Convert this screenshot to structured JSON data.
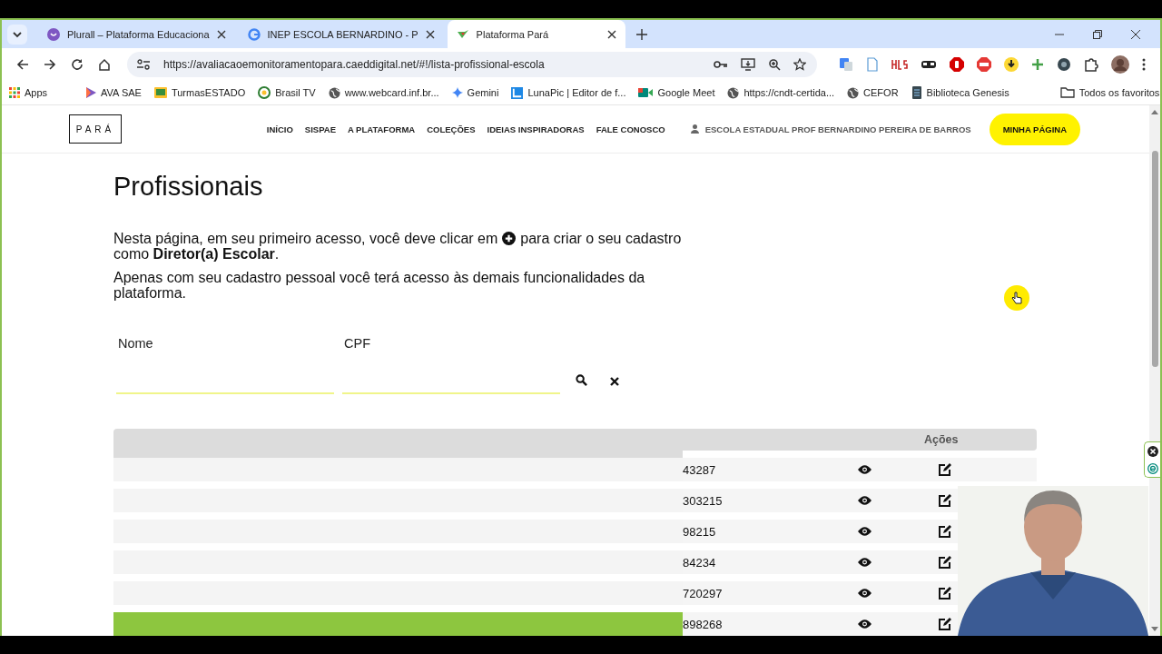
{
  "browser": {
    "tabs": [
      {
        "title": "Plurall – Plataforma Educaciona",
        "selected": false
      },
      {
        "title": "INEP ESCOLA BERNARDINO - P",
        "selected": false
      },
      {
        "title": "Plataforma Pará",
        "selected": true
      }
    ],
    "url": "https://avaliacaoemonitoramentopara.caeddigital.net/#!/lista-profissional-escola",
    "bookmarks": [
      {
        "label": "Apps"
      },
      {
        "label": "AVA SAE"
      },
      {
        "label": "TurmasESTADO"
      },
      {
        "label": "Brasil TV"
      },
      {
        "label": "www.webcard.inf.br..."
      },
      {
        "label": "Gemini"
      },
      {
        "label": "LunaPic | Editor de f..."
      },
      {
        "label": "Google Meet"
      },
      {
        "label": "https://cndt-certida..."
      },
      {
        "label": "CEFOR"
      },
      {
        "label": "Biblioteca Genesis"
      }
    ],
    "all_bookmarks": "Todos os favoritos"
  },
  "site": {
    "logo": "PARÁ",
    "nav": [
      "INÍCIO",
      "SISPAE",
      "A PLATAFORMA",
      "COLEÇÕES",
      "IDEIAS INSPIRADORAS",
      "FALE CONOSCO"
    ],
    "school": "ESCOLA ESTADUAL PROF BERNARDINO PEREIRA DE BARROS",
    "my_page": "MINHA PÁGINA"
  },
  "page": {
    "title": "Profissionais",
    "intro_before": "Nesta página, em seu primeiro acesso, você deve clicar em",
    "intro_middle": "para criar o seu cadastro",
    "intro_end": "como **Diretor(a) Escolar**.",
    "note": "Apenas com seu cadastro pessoal você terá acesso às demais funcionalidades da plataforma.",
    "filters": [
      {
        "label": "Nome"
      },
      {
        "label": "CPF"
      }
    ],
    "table": {
      "actions_header": "Ações",
      "rows": [
        {
          "cpf": "43287"
        },
        {
          "cpf": "303215"
        },
        {
          "cpf": "98215"
        },
        {
          "cpf": "84234"
        },
        {
          "cpf": "720297"
        },
        {
          "cpf": "898268"
        }
      ]
    }
  }
}
